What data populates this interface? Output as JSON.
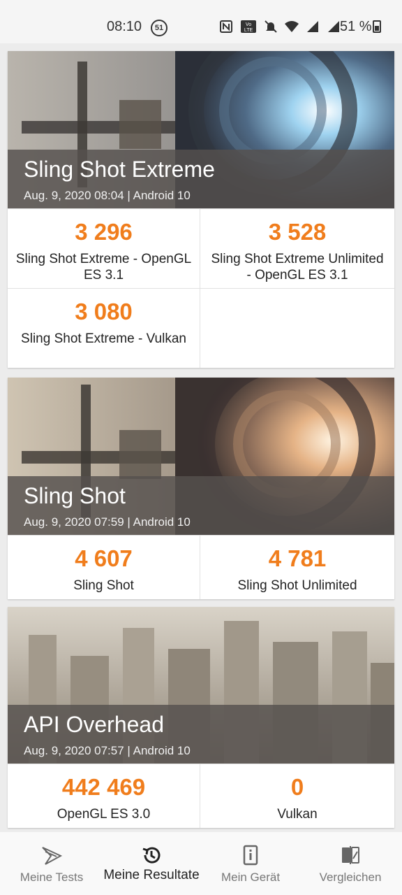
{
  "status_bar": {
    "time": "08:10",
    "notification_count": "51",
    "battery_text": "51 %",
    "icons": [
      "nfc-icon",
      "volte-icon",
      "mute-icon",
      "wifi-icon",
      "signal-icon",
      "signal-icon",
      "battery-icon"
    ]
  },
  "colors": {
    "score": "#f07d1c",
    "caption_overlay": "#55504e"
  },
  "cards": [
    {
      "title": "Sling Shot Extreme",
      "subtitle": "Aug. 9, 2020 08:04 | Android 10",
      "results": [
        {
          "score": "3 296",
          "label": "Sling Shot Extreme - OpenGL ES 3.1"
        },
        {
          "score": "3 528",
          "label": "Sling Shot Extreme Unlimited - OpenGL ES 3.1"
        },
        {
          "score": "3 080",
          "label": "Sling Shot Extreme - Vulkan"
        }
      ]
    },
    {
      "title": "Sling Shot",
      "subtitle": "Aug. 9, 2020 07:59 | Android 10",
      "results": [
        {
          "score": "4 607",
          "label": "Sling Shot"
        },
        {
          "score": "4 781",
          "label": "Sling Shot Unlimited"
        }
      ]
    },
    {
      "title": "API Overhead",
      "subtitle": "Aug. 9, 2020 07:57 | Android 10",
      "results": [
        {
          "score": "442 469",
          "label": "OpenGL ES 3.0"
        },
        {
          "score": "0",
          "label": "Vulkan"
        }
      ]
    }
  ],
  "bottom_nav": [
    {
      "label": "Meine Tests",
      "icon": "3dmark-logo-icon",
      "active": false
    },
    {
      "label": "Meine Resultate",
      "icon": "history-icon",
      "active": true
    },
    {
      "label": "Mein Gerät",
      "icon": "device-info-icon",
      "active": false
    },
    {
      "label": "Vergleichen",
      "icon": "compare-icon",
      "active": false
    }
  ]
}
